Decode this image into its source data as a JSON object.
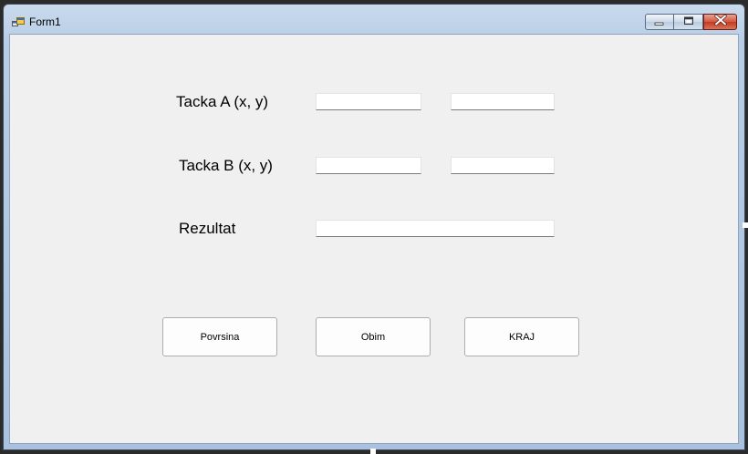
{
  "window": {
    "title": "Form1",
    "icon": "winforms-app-icon",
    "controls": {
      "minimize": "minimize-icon",
      "maximize": "maximize-icon",
      "close": "close-icon"
    }
  },
  "form": {
    "tacka_a": {
      "label": "Tacka A (x, y)",
      "x_value": "",
      "y_value": ""
    },
    "tacka_b": {
      "label": "Tacka B (x, y)",
      "x_value": "",
      "y_value": ""
    },
    "rezultat": {
      "label": "Rezultat",
      "value": ""
    }
  },
  "buttons": {
    "povrsina": "Povrsina",
    "obim": "Obim",
    "kraj": "KRAJ"
  },
  "colors": {
    "client_bg": "#f0f0f0",
    "close_button": "#c23a1d",
    "titlebar": "#b9cee6"
  }
}
